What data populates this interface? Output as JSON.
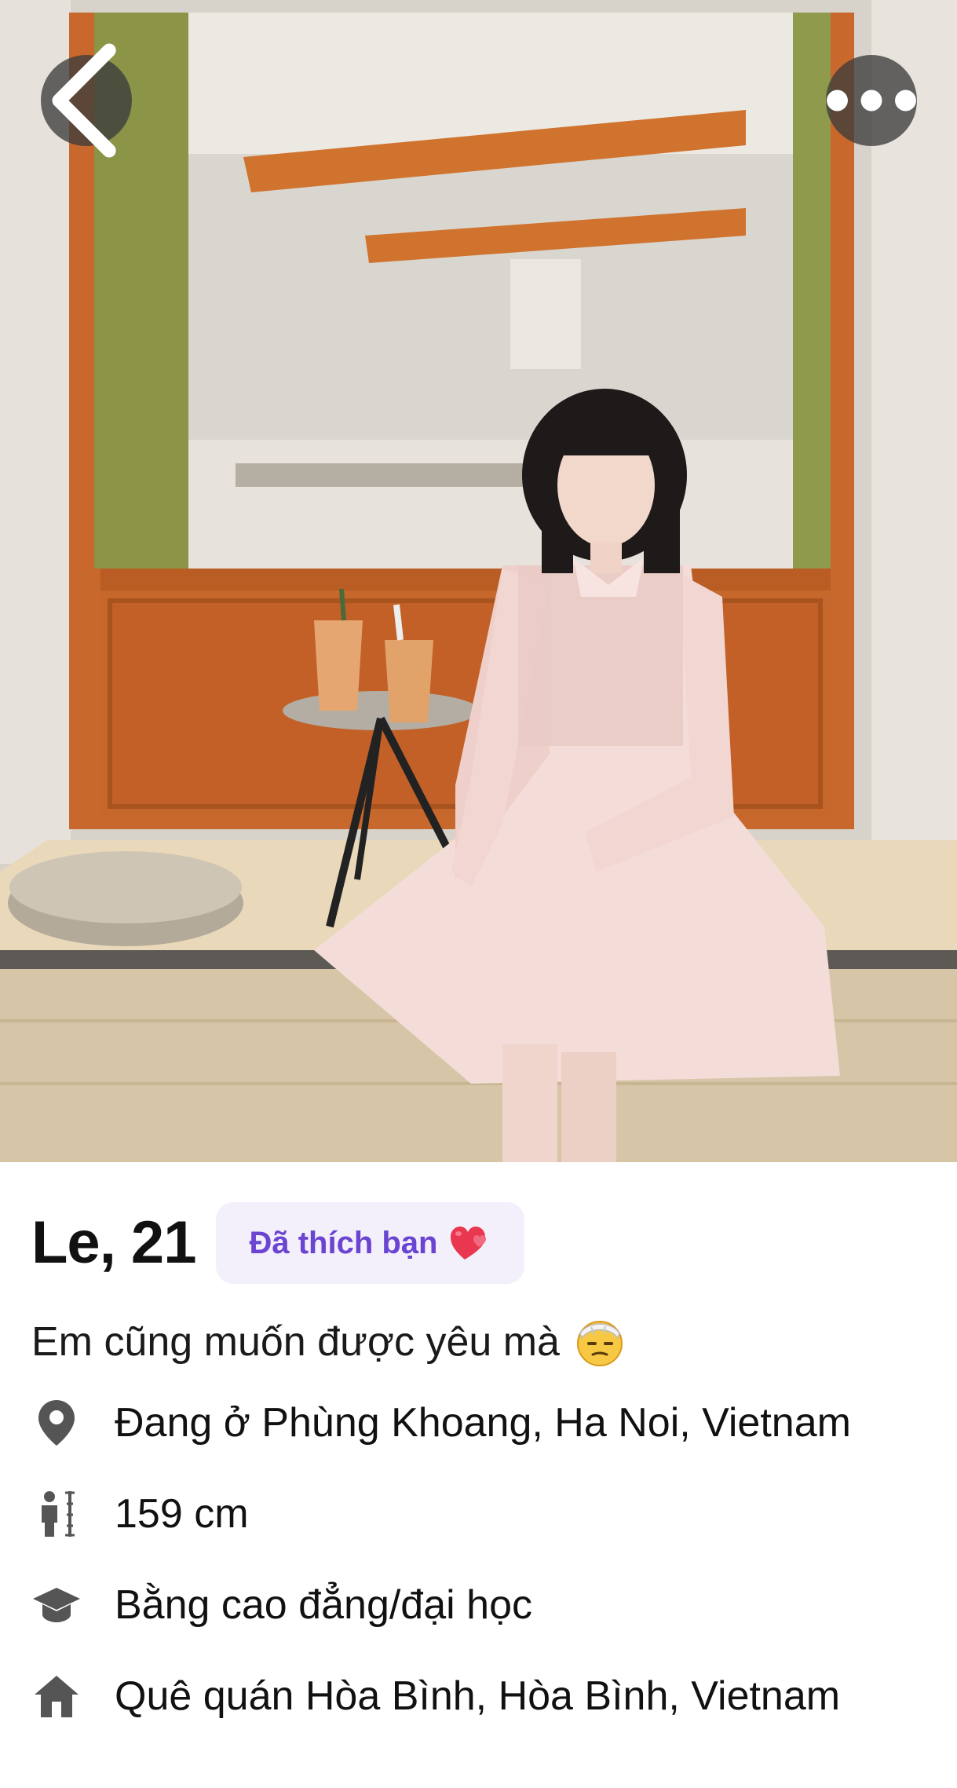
{
  "profile": {
    "name_age": "Le, 21",
    "liked_badge": "Đã thích bạn",
    "liked_badge_icon": "heart-emoji",
    "bio": "Em cũng muốn được yêu mà",
    "bio_icon": "bandaged-face-emoji",
    "details": [
      {
        "icon": "location-pin-icon",
        "text": "Đang ở Phùng Khoang, Ha Noi, Vietnam"
      },
      {
        "icon": "height-icon",
        "text": "159 cm"
      },
      {
        "icon": "graduation-cap-icon",
        "text": "Bằng cao đẳng/đại học"
      },
      {
        "icon": "home-icon",
        "text": "Quê quán Hòa Bình, Hòa Bình, Vietnam"
      }
    ]
  },
  "nav": {
    "back_icon": "chevron-left-icon",
    "more_icon": "more-dots-icon"
  },
  "colors": {
    "badge_bg": "#f3f0fb",
    "badge_text": "#6b44d1",
    "icon_gray": "#555555"
  }
}
